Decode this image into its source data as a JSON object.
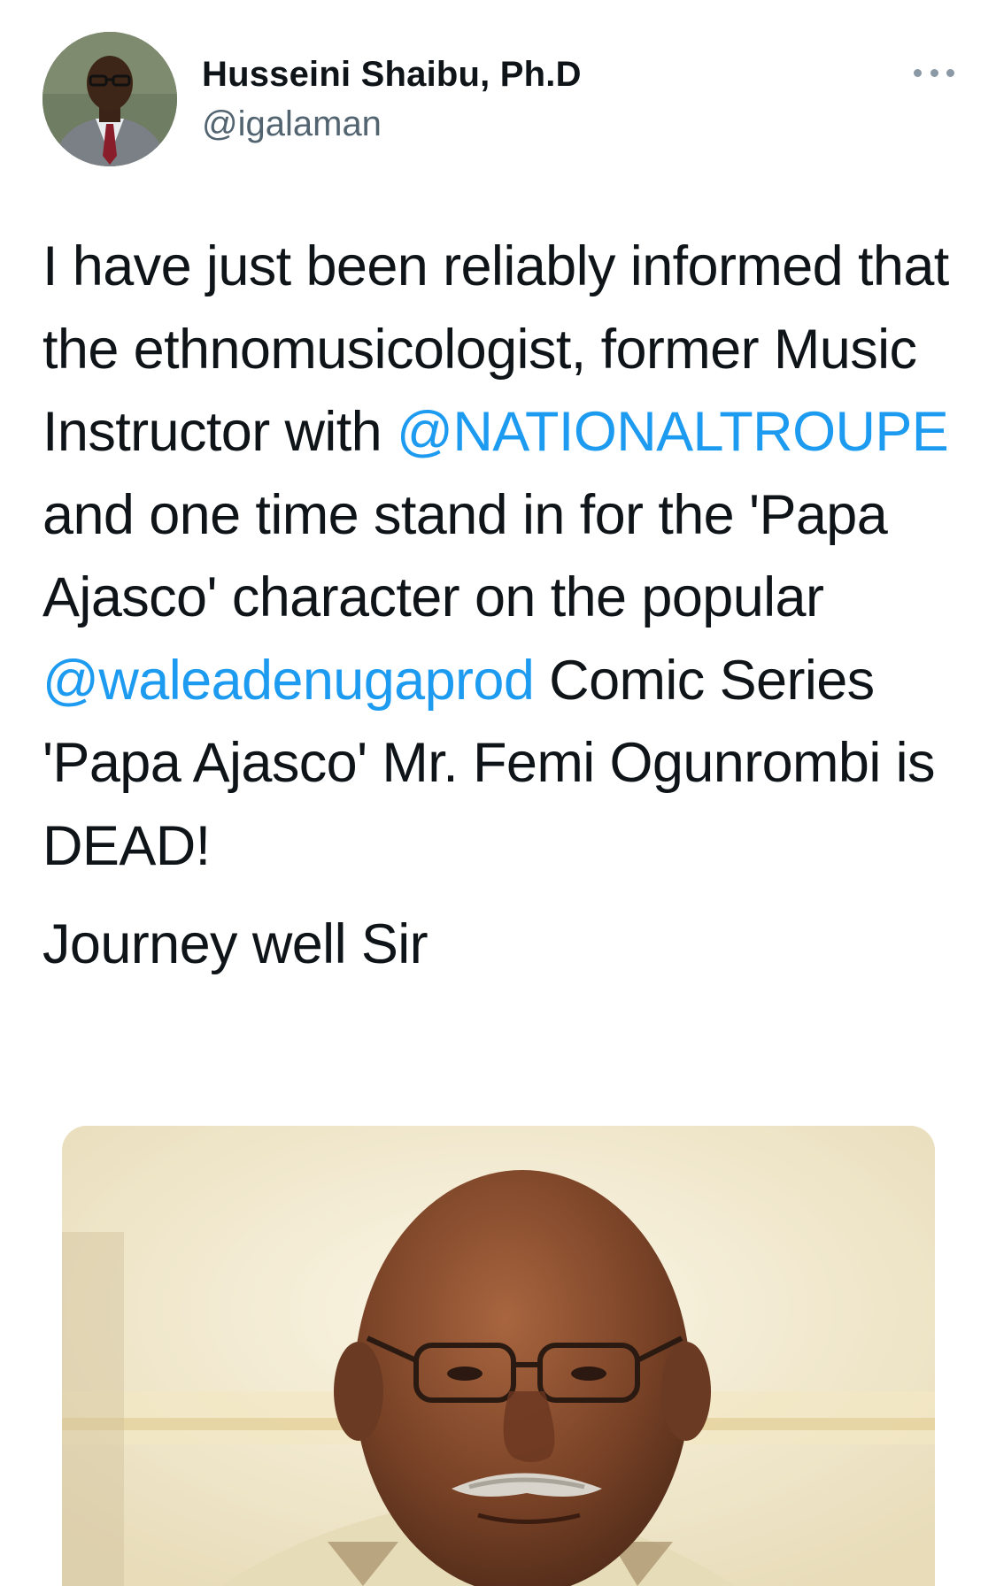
{
  "tweet": {
    "author": {
      "name": "Husseini Shaibu, Ph.D",
      "handle": "@igalaman"
    },
    "more_icon": "more-horizontal-icon",
    "text": {
      "p1_seg1": "I have just been reliably informed that the ethnomusicologist, former Music Instructor with ",
      "mention1": "@NATIONALTROUPE",
      "p1_seg2": " and one time stand in for the 'Papa Ajasco' character on the popular ",
      "mention2": "@waleadenugaprod",
      "p1_seg3": " Comic Series 'Papa Ajasco' Mr. Femi Ogunrombi is DEAD!",
      "p2": "Journey well Sir"
    },
    "colors": {
      "mention": "#1d9bf0",
      "text": "#0f1419",
      "handle": "#536471"
    }
  }
}
